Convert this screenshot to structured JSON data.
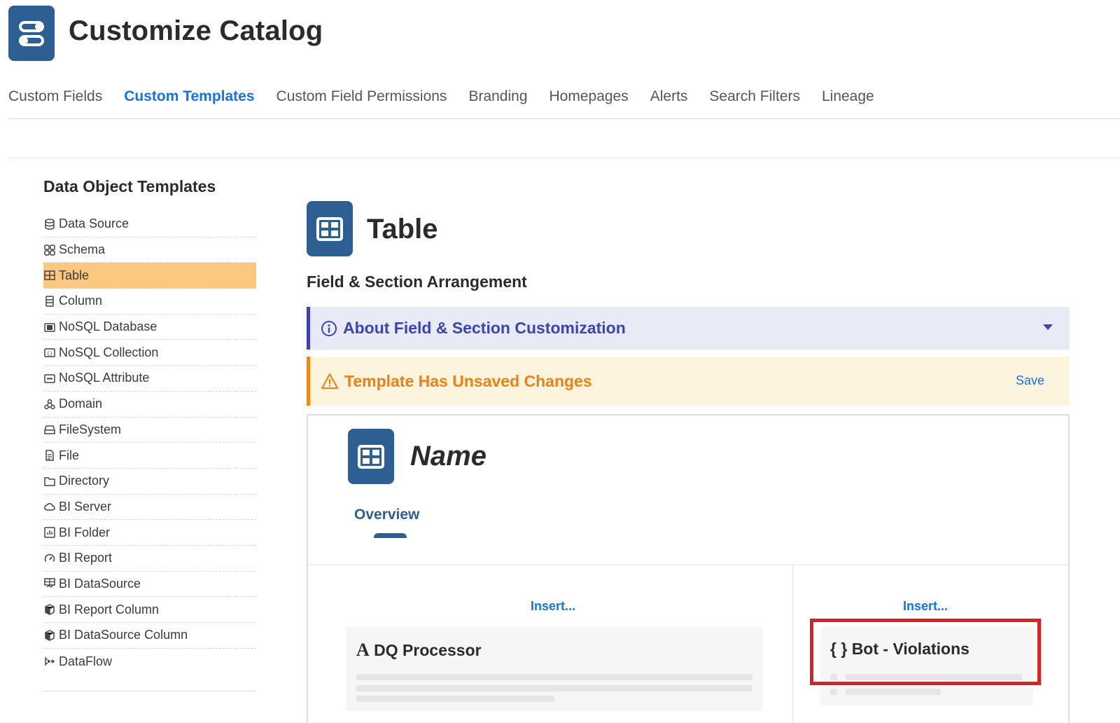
{
  "header": {
    "title": "Customize Catalog",
    "logo_icon": "toggle-sliders-icon"
  },
  "tabs": [
    {
      "label": "Custom Fields",
      "active": false
    },
    {
      "label": "Custom Templates",
      "active": true
    },
    {
      "label": "Custom Field Permissions",
      "active": false
    },
    {
      "label": "Branding",
      "active": false
    },
    {
      "label": "Homepages",
      "active": false
    },
    {
      "label": "Alerts",
      "active": false
    },
    {
      "label": "Search Filters",
      "active": false
    },
    {
      "label": "Lineage",
      "active": false
    }
  ],
  "sidebar": {
    "title": "Data Object Templates",
    "items": [
      {
        "label": "Data Source",
        "icon": "database-icon"
      },
      {
        "label": "Schema",
        "icon": "schema-icon"
      },
      {
        "label": "Table",
        "icon": "table-icon",
        "active": true
      },
      {
        "label": "Column",
        "icon": "column-icon"
      },
      {
        "label": "NoSQL Database",
        "icon": "nosql-database-icon"
      },
      {
        "label": "NoSQL Collection",
        "icon": "nosql-collection-icon"
      },
      {
        "label": "NoSQL Attribute",
        "icon": "nosql-attribute-icon"
      },
      {
        "label": "Domain",
        "icon": "domain-icon"
      },
      {
        "label": "FileSystem",
        "icon": "filesystem-icon"
      },
      {
        "label": "File",
        "icon": "file-icon"
      },
      {
        "label": "Directory",
        "icon": "folder-icon"
      },
      {
        "label": "BI Server",
        "icon": "cloud-icon"
      },
      {
        "label": "BI Folder",
        "icon": "bi-folder-icon"
      },
      {
        "label": "BI Report",
        "icon": "gauge-icon"
      },
      {
        "label": "BI DataSource",
        "icon": "bi-datasource-icon"
      },
      {
        "label": "BI Report Column",
        "icon": "cube-icon"
      },
      {
        "label": "BI DataSource Column",
        "icon": "cube-icon"
      },
      {
        "label": "DataFlow",
        "icon": "dataflow-icon"
      }
    ]
  },
  "main": {
    "title": "Table",
    "section_heading": "Field & Section Arrangement",
    "info_banner": "About Field & Section Customization",
    "warning_banner": "Template Has Unsaved Changes",
    "save_label": "Save",
    "preview": {
      "name_title": "Name",
      "overview_tab": "Overview",
      "left_insert": "Insert...",
      "right_insert": "Insert...",
      "left_card_icon": "A",
      "left_card_title": "DQ Processor",
      "right_card_icon": "{ }",
      "right_card_title": "Bot - Violations"
    }
  },
  "colors": {
    "brand_blue": "#2d5f93",
    "link_blue": "#1473e6",
    "active_item": "#fcc77e",
    "info_accent": "#3a44b3",
    "warning_accent": "#f08a16",
    "highlight_red": "#d9231f"
  }
}
